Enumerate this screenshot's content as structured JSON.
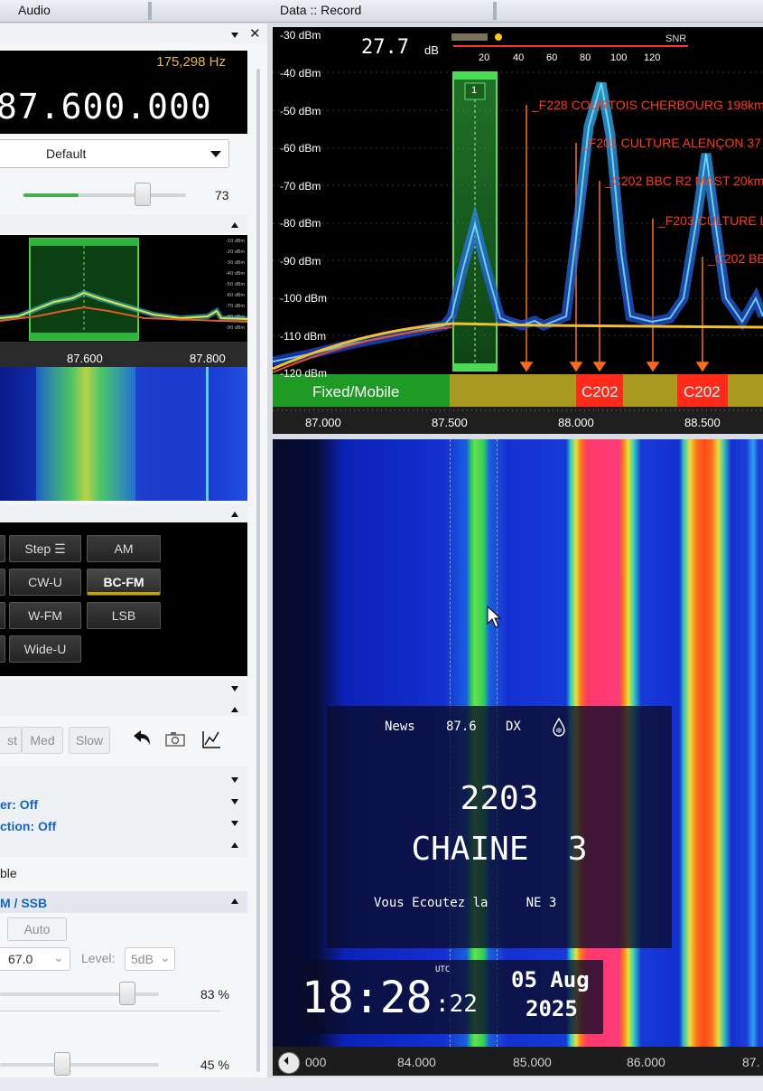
{
  "topbar": {
    "audio_tab": "Audio",
    "record_tab": "Data :: Record"
  },
  "left_panel": {
    "close_glyph": "✕",
    "offset_hz": "175,298 Hz",
    "frequency": "87.600.000",
    "profile": "Default",
    "gain_value": "73",
    "gain_fraction": 0.73,
    "mini_axis": [
      "87.600",
      "87.800"
    ],
    "mode_buttons": [
      {
        "label": "Step ☰",
        "active": false
      },
      {
        "label": "AM",
        "active": false
      },
      {
        "label": "CW-U",
        "active": false
      },
      {
        "label": "BC-FM",
        "active": true
      },
      {
        "label": "W-FM",
        "active": false
      },
      {
        "label": "LSB",
        "active": false
      },
      {
        "label": "Wide-U",
        "active": false
      }
    ],
    "agc": {
      "fast": "st",
      "med": "Med",
      "slow": "Slow"
    },
    "filter_line1": "er: Off",
    "filter_line2": "ction: Off",
    "enable_label": "ble",
    "mode_section": "M / SSB",
    "auto_label": "Auto",
    "ctcss_value": "67.0",
    "level_label": "Level:",
    "level_value": "5dB",
    "squelch_percent": "83 %",
    "squelch_fraction": 0.83,
    "volume_percent": "45 %",
    "volume_fraction": 0.45
  },
  "spectrum": {
    "snr_db": "27.7",
    "snr_unit": "dB",
    "snr_label": "SNR",
    "snr_scale": [
      "20",
      "40",
      "60",
      "80",
      "100",
      "120"
    ],
    "y_labels": [
      "-30 dBm",
      "-40 dBm",
      "-50 dBm",
      "-60 dBm",
      "-70 dBm",
      "-80 dBm",
      "-90 dBm",
      "-100 dBm",
      "-110 dBm",
      "-120 dBm"
    ],
    "channel_marker": "1",
    "stations": [
      "_F228 COURTOIS CHERBOURG 198km",
      "_F201 CULTURE ALENÇON 37",
      "_C202 BBC R2 MAST 20km",
      "_F203 CULTURE L",
      "_C202 BBC"
    ],
    "band_fixed": "Fixed/Mobile",
    "band_c202_a": "C202",
    "band_c202_b": "C202",
    "x_labels": [
      "87.000",
      "87.500",
      "88.000",
      "88.500"
    ]
  },
  "rds": {
    "pty": "News",
    "freq": "87.6",
    "dx": "DX",
    "pi": "2203",
    "ps": "CHAINE  3",
    "rt": "Vous Ecoutez la     NE 3"
  },
  "clock": {
    "utc": "UTC",
    "hhmm": "18:28",
    "ss": ":22",
    "date": "05 Aug",
    "year": "2025"
  },
  "waterfall_axis": [
    "000",
    "84.000",
    "85.000",
    "86.000",
    "87."
  ]
}
